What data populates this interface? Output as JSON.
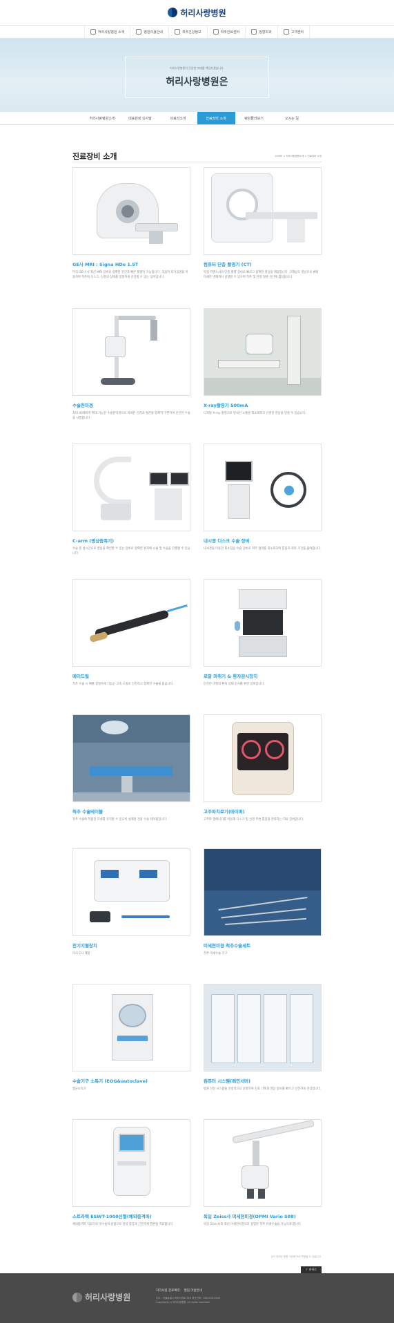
{
  "brand": {
    "name": "허리사랑병원"
  },
  "gnb": [
    {
      "label": "허리사랑병원 소개"
    },
    {
      "label": "병원이용안내"
    },
    {
      "label": "척추건강정보"
    },
    {
      "label": "척추진료센터"
    },
    {
      "label": "정형외과"
    },
    {
      "label": "고객센터"
    }
  ],
  "hero": {
    "subtitle": "허리사랑병원이 건강한 미래를 책임지겠습니다.",
    "title": "허리사랑병원은"
  },
  "subnav": [
    {
      "label": "허리사랑병원소개",
      "active": false
    },
    {
      "label": "대표원장 인사말",
      "active": false
    },
    {
      "label": "의료진소개",
      "active": false
    },
    {
      "label": "진료장비 소개",
      "active": true
    },
    {
      "label": "병원둘러보기",
      "active": false
    },
    {
      "label": "오시는 길",
      "active": false
    }
  ],
  "section": {
    "title": "진료장비 소개",
    "breadcrumb": "HOME > 허리사랑병원소개 > 진료장비 소개"
  },
  "equipment": [
    {
      "title": "GE사 MRI : Signa HDe 1.5T",
      "desc": "미국 GE사 사 최신 MRI 장비로 정확한 진단과 빠른 촬영이 가능합니다. 초음파 자기공명을 이용하여 척추와 디스크, 신경의 상태를 정밀하게 진단할 수 있는 장비입니다.",
      "icon": "mri-icon"
    },
    {
      "title": "컴퓨터 단층 촬영기 (CT)",
      "desc": "독일 지멘스사의 단층 촬영 장비로 빠르고 정확한 영상을 제공합니다. 고해상도 영상으로 뼈의 미세한 변화까지 관찰할 수 있으며 척추 및 관절 질환 진단에 활용됩니다.",
      "icon": "ct-scanner-icon"
    },
    {
      "title": "수술현미경",
      "desc": "최대 40배까지 확대 가능한 수술현미경으로 미세한 신경과 혈관을 정확히 구분하여 안전한 수술을 시행합니다.",
      "icon": "surgical-microscope-icon"
    },
    {
      "title": "X-ray촬영기 500mA",
      "desc": "디지털 X-ray 촬영기로 방사선 노출을 최소화하고 선명한 영상을 얻을 수 있습니다.",
      "icon": "xray-icon"
    },
    {
      "title": "C-arm (영상증폭기)",
      "desc": "수술 중 실시간으로 영상을 확인할 수 있는 장비로 정확한 위치에 시술 및 수술을 진행할 수 있습니다.",
      "icon": "c-arm-icon"
    },
    {
      "title": "내시경 디스크 수술 장비",
      "desc": "내시경을 이용한 최소침습 수술 장비로 피부 절개를 최소화하여 통증과 회복 기간을 줄여줍니다.",
      "icon": "endoscope-icon"
    },
    {
      "title": "메이드릴",
      "desc": "척추 수술 시 뼈를 정밀하게 다듬는 고속 드릴로 안전하고 정확한 수술을 돕습니다.",
      "icon": "drill-icon"
    },
    {
      "title": "로말 마취기 & 환자감시장치",
      "desc": "안전한 마취와 환자 상태 감시를 위한 장비입니다.",
      "icon": "anesthesia-icon"
    },
    {
      "title": "척추 수술테이블",
      "desc": "척추 수술에 적합한 자세를 유지할 수 있도록 설계된 전용 수술 테이블입니다.",
      "icon": "surgical-table-icon"
    },
    {
      "title": "고주파치료기(테이퍼)",
      "desc": "고주파 열에너지를 이용해 디스크 및 신경 주변 통증을 완화하는 치료 장비입니다.",
      "icon": "rf-therapy-icon"
    },
    {
      "title": "전기지혈장치",
      "desc": "미국 C사 제품",
      "icon": "electrosurgical-icon"
    },
    {
      "title": "미세현미경 척추수술세트",
      "desc": "척추 미세수술 기구",
      "icon": "micro-instruments-icon"
    },
    {
      "title": "수술기구 소독기 (EOG&autoclave)",
      "desc": "멸균소독기",
      "icon": "sterilizer-icon"
    },
    {
      "title": "컴퓨터 시스템(메인서버)",
      "desc": "병원 전산 시스템을 안정적으로 운영하여 진료 기록과 영상 정보를 빠르고 안전하게 관리합니다.",
      "icon": "server-icon"
    },
    {
      "title": "스트라텍 ESWT-1000신형(체외충격파)",
      "desc": "체외충격파 치료기로 비수술적 방법으로 만성 통증과 근골격계 질환을 치료합니다.",
      "icon": "eswt-icon"
    },
    {
      "title": "독일 Zeiss사 미세현미경(OPMI Vario S88)",
      "desc": "독일 Zeiss사의 최신 미세현미경으로 정밀한 척추 미세수술을 가능하게 합니다.",
      "icon": "zeiss-microscope-icon"
    }
  ],
  "bottom_note": "상기 장비는 병원 사정에 따라 변경될 수 있습니다.",
  "top_button": "↑ 맨위로",
  "footer": {
    "links": [
      "허리사랑 진료예약",
      "병원 이용안내"
    ],
    "info": [
      "주소 : 서울특별시 허리사랑로 000  대표전화 : 000-000-0000",
      "Copyright (c) 허리사랑병원. All rights reserved."
    ]
  },
  "colors": {
    "accent": "#2b9ad6",
    "footer": "#4a4a4a"
  }
}
